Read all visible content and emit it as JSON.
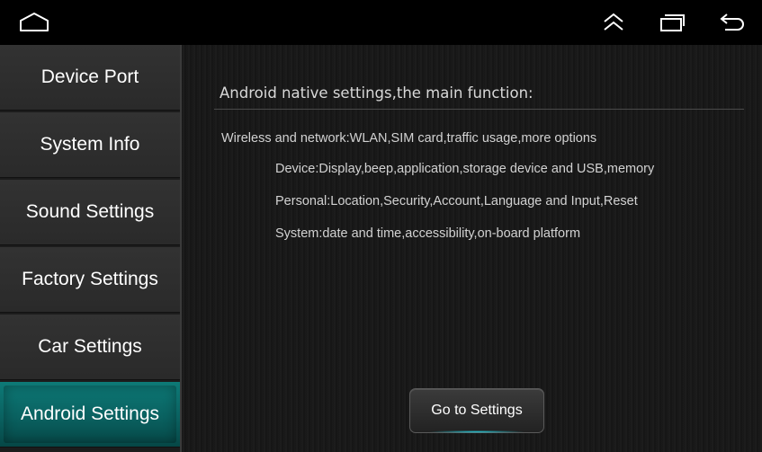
{
  "navbar": {
    "icons": [
      "home-icon",
      "expand-up-icon",
      "recents-icon",
      "back-icon"
    ]
  },
  "sidebar": {
    "items": [
      {
        "label": "Device Port",
        "active": false
      },
      {
        "label": "System Info",
        "active": false
      },
      {
        "label": "Sound Settings",
        "active": false
      },
      {
        "label": "Factory Settings",
        "active": false
      },
      {
        "label": "Car Settings",
        "active": false
      },
      {
        "label": "Android Settings",
        "active": true
      }
    ]
  },
  "main": {
    "heading": "Android native settings,the main function:",
    "lines": [
      "Wireless and network:WLAN,SIM card,traffic usage,more options",
      "Device:Display,beep,application,storage device and USB,memory",
      "Personal:Location,Security,Account,Language and Input,Reset",
      "System:date and time,accessibility,on-board platform"
    ],
    "button_label": "Go to Settings"
  },
  "colors": {
    "active_item": "#0a6160",
    "accent_glow": "#29c9d8",
    "background": "#000000"
  }
}
